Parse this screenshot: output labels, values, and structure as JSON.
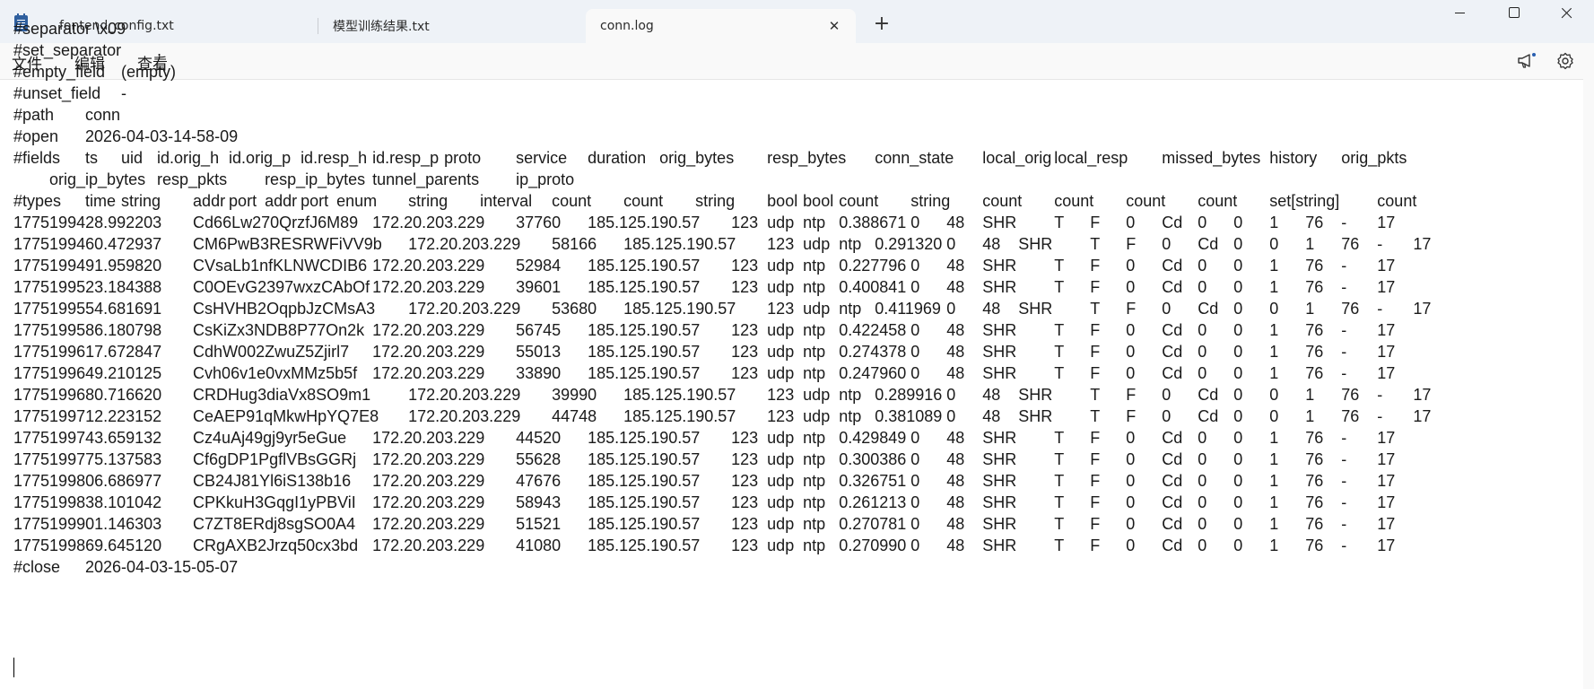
{
  "tabs": [
    {
      "label": "fontend_config.txt",
      "active": false
    },
    {
      "label": "模型训练结果.txt",
      "active": false
    },
    {
      "label": "conn.log",
      "active": true
    }
  ],
  "icons": {
    "app": "notepad-icon",
    "close_tab": "close-icon",
    "add_tab": "plus-icon",
    "announce": "megaphone-icon",
    "settings": "gear-icon"
  },
  "glyphs": {
    "close": "✕",
    "plus": "+"
  },
  "menu": {
    "file": "文件",
    "edit": "编辑",
    "view": "查看"
  },
  "document": {
    "lines": [
      "#separator \\x09",
      "#set_separator\t,",
      "#empty_field\t(empty)",
      "#unset_field\t-",
      "#path\tconn",
      "#open\t2026-04-03-14-58-09",
      "#fields\tts\tuid\tid.orig_h\tid.orig_p\tid.resp_h\tid.resp_p\tproto\tservice\tduration\torig_bytes\tresp_bytes\tconn_state\tlocal_orig\tlocal_resp\tmissed_bytes\thistory\torig_pkts",
      "\torig_ip_bytes\tresp_pkts\tresp_ip_bytes\ttunnel_parents\tip_proto",
      "#types\ttime\tstring\taddr\tport\taddr\tport\tenum\tstring\tinterval\tcount\tcount\tstring\tbool\tbool\tcount\tstring\tcount\tcount\tcount\tcount\tset[string]\tcount",
      "1775199428.992203\tCd66Lw270QrzfJ6M89\t172.20.203.229\t37760\t185.125.190.57\t123\tudp\tntp\t0.388671\t0\t48\tSHR\tT\tF\t0\tCd\t0\t0\t1\t76\t-\t17",
      "1775199460.472937\tCM6PwB3RESRWFiVV9b\t172.20.203.229\t58166\t185.125.190.57\t123\tudp\tntp\t0.291320\t0\t48\tSHR\tT\tF\t0\tCd\t0\t0\t1\t76\t-\t17",
      "1775199491.959820\tCVsaLb1nfKLNWCDIB6\t172.20.203.229\t52984\t185.125.190.57\t123\tudp\tntp\t0.227796\t0\t48\tSHR\tT\tF\t0\tCd\t0\t0\t1\t76\t-\t17",
      "1775199523.184388\tC0OEvG2397wxzCAbOf\t172.20.203.229\t39601\t185.125.190.57\t123\tudp\tntp\t0.400841\t0\t48\tSHR\tT\tF\t0\tCd\t0\t0\t1\t76\t-\t17",
      "1775199554.681691\tCsHVHB2OqpbJzCMsA3\t172.20.203.229\t53680\t185.125.190.57\t123\tudp\tntp\t0.411969\t0\t48\tSHR\tT\tF\t0\tCd\t0\t0\t1\t76\t-\t17",
      "1775199586.180798\tCsKiZx3NDB8P77On2k\t172.20.203.229\t56745\t185.125.190.57\t123\tudp\tntp\t0.422458\t0\t48\tSHR\tT\tF\t0\tCd\t0\t0\t1\t76\t-\t17",
      "1775199617.672847\tCdhW002ZwuZ5Zjirl7\t172.20.203.229\t55013\t185.125.190.57\t123\tudp\tntp\t0.274378\t0\t48\tSHR\tT\tF\t0\tCd\t0\t0\t1\t76\t-\t17",
      "1775199649.210125\tCvh06v1e0vxMMz5b5f\t172.20.203.229\t33890\t185.125.190.57\t123\tudp\tntp\t0.247960\t0\t48\tSHR\tT\tF\t0\tCd\t0\t0\t1\t76\t-\t17",
      "1775199680.716620\tCRDHug3diaVx8SO9m1\t172.20.203.229\t39990\t185.125.190.57\t123\tudp\tntp\t0.289916\t0\t48\tSHR\tT\tF\t0\tCd\t0\t0\t1\t76\t-\t17",
      "1775199712.223152\tCeAEP91qMkwHpYQ7E8\t172.20.203.229\t44748\t185.125.190.57\t123\tudp\tntp\t0.381089\t0\t48\tSHR\tT\tF\t0\tCd\t0\t0\t1\t76\t-\t17",
      "1775199743.659132\tCz4uAj49gj9yr5eGue\t172.20.203.229\t44520\t185.125.190.57\t123\tudp\tntp\t0.429849\t0\t48\tSHR\tT\tF\t0\tCd\t0\t0\t1\t76\t-\t17",
      "1775199775.137583\tCf6gDP1PgflVBsGGRj\t172.20.203.229\t55628\t185.125.190.57\t123\tudp\tntp\t0.300386\t0\t48\tSHR\tT\tF\t0\tCd\t0\t0\t1\t76\t-\t17",
      "1775199806.686977\tCB24J81Yl6iS138b16\t172.20.203.229\t47676\t185.125.190.57\t123\tudp\tntp\t0.326751\t0\t48\tSHR\tT\tF\t0\tCd\t0\t0\t1\t76\t-\t17",
      "1775199838.101042\tCPKkuH3GqgI1yPBViI\t172.20.203.229\t58943\t185.125.190.57\t123\tudp\tntp\t0.261213\t0\t48\tSHR\tT\tF\t0\tCd\t0\t0\t1\t76\t-\t17",
      "1775199901.146303\tC7ZT8ERdj8sgSO0A4\t172.20.203.229\t51521\t185.125.190.57\t123\tudp\tntp\t0.270781\t0\t48\tSHR\tT\tF\t0\tCd\t0\t0\t1\t76\t-\t17",
      "1775199869.645120\tCRgAXB2Jrzq50cx3bd\t172.20.203.229\t41080\t185.125.190.57\t123\tudp\tntp\t0.270990\t0\t48\tSHR\tT\tF\t0\tCd\t0\t0\t1\t76\t-\t17",
      "#close\t2026-04-03-15-05-07"
    ]
  }
}
